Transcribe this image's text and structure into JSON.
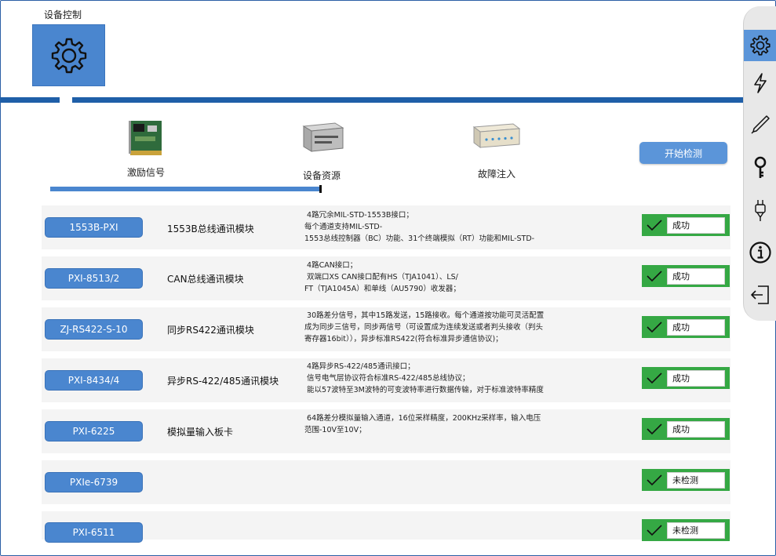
{
  "header": {
    "title": "设备控制"
  },
  "steps": [
    {
      "label": "激励信号",
      "image": "pci-card"
    },
    {
      "label": "设备资源",
      "image": "industrial-computer"
    },
    {
      "label": "故障注入",
      "image": "fault-injection-box"
    }
  ],
  "progress": {
    "fraction": 0.4
  },
  "actions": {
    "start_label": "开始检测"
  },
  "modules": [
    {
      "id": "1553B-PXI",
      "name": "1553B总线通讯模块",
      "desc": " 4路冗余MIL-STD-1553B接口；\n每个通道支持MIL-STD-\n1553总线控制器（BC）功能、31个终端模拟（RT）功能和MIL-STD-",
      "status": "成功"
    },
    {
      "id": "PXI-8513/2",
      "name": "CAN总线通讯模块",
      "desc": " 4路CAN接口；\n 双端口XS CAN接口配有HS（TJA1041）、LS/\nFT（TJA1045A）和单线（AU5790）收发器；",
      "status": "成功"
    },
    {
      "id": "ZJ-RS422-S-10",
      "name": "同步RS422通讯模块",
      "desc": " 30路差分信号，其中15路发送，15路接收。每个通道按功能可灵活配置\n成为同步三信号，同步两信号（可设置成为连续发送或者判头接收（判头\n寄存器16bit）），异步标准RS422(符合标准异步通信协议)；",
      "status": "成功"
    },
    {
      "id": "PXI-8434/4",
      "name": "异步RS-422/485通讯模块",
      "desc": " 4路异步RS-422/485通讯接口；\n 信号电气层协议符合标准RS-422/485总线协议；\n 能以57波特至3M波特的可变波特率进行数据传输，对于标准波特率精度",
      "status": "成功"
    },
    {
      "id": "PXI-6225",
      "name": "模拟量输入板卡",
      "desc": " 64路差分模拟量输入通道，16位采样精度，200KHz采样率，输入电压\n范围-10V至10V；",
      "status": "成功"
    },
    {
      "id": "PXIe-6739",
      "name": "",
      "desc": "",
      "status": "未检测"
    },
    {
      "id": "PXI-6511",
      "name": "",
      "desc": "",
      "status": "未检测"
    }
  ],
  "sidebar": {
    "items": [
      {
        "icon": "gear-icon",
        "active": true
      },
      {
        "icon": "lightning-icon",
        "active": false
      },
      {
        "icon": "pen-icon",
        "active": false
      },
      {
        "icon": "key-icon",
        "active": false
      },
      {
        "icon": "plug-icon",
        "active": false
      },
      {
        "icon": "info-icon",
        "active": false
      },
      {
        "icon": "logout-icon",
        "active": false
      }
    ]
  },
  "colors": {
    "accent": "#4a86cf",
    "divider": "#1f5fa8",
    "success": "#35a844"
  }
}
